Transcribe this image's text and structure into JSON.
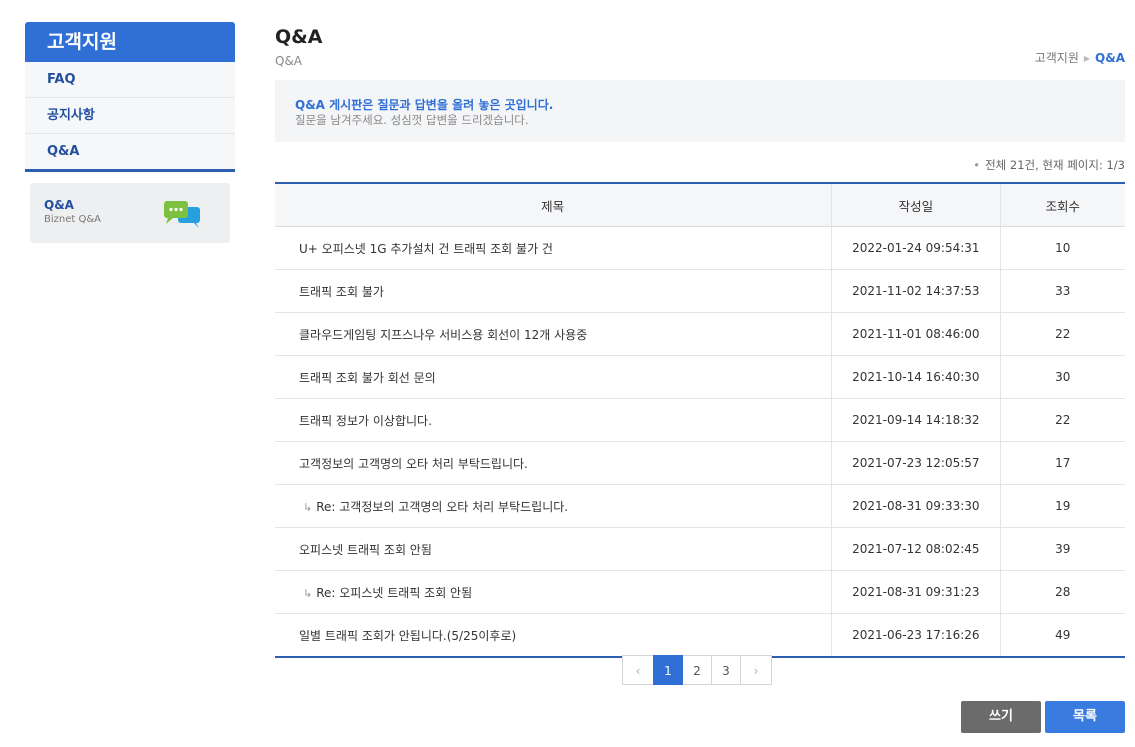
{
  "sidebar": {
    "title": "고객지원",
    "items": [
      {
        "label": "FAQ"
      },
      {
        "label": "공지사항"
      },
      {
        "label": "Q&A"
      }
    ],
    "card": {
      "title": "Q&A",
      "subtitle": "Biznet Q&A",
      "icon": "chat-bubbles-icon"
    }
  },
  "header": {
    "title": "Q&A",
    "subtitle": "Q&A",
    "breadcrumb": [
      "고객지원",
      "Q&A"
    ]
  },
  "notice": {
    "line1": "Q&A 게시판은 질문과 답변을 올려 놓은 곳입니다.",
    "line2": "질문을 남겨주세요. 성심껏 답변을 드리겠습니다."
  },
  "count": "전체 21건, 현재 페이지: 1/3",
  "table": {
    "columns": [
      "제목",
      "작성일",
      "조회수"
    ],
    "rows": [
      {
        "title": "U+ 오피스넷 1G 추가설치 건 트래픽 조회 불가 건",
        "date": "2022-01-24 09:54:31",
        "hits": "10",
        "reply": false
      },
      {
        "title": "트래픽 조회 불가",
        "date": "2021-11-02 14:37:53",
        "hits": "33",
        "reply": false
      },
      {
        "title": "클라우드게임팅 지프스나우 서비스용 회선이 12개 사용중",
        "date": "2021-11-01 08:46:00",
        "hits": "22",
        "reply": false
      },
      {
        "title": "트래픽 조회 불가 회선 문의",
        "date": "2021-10-14 16:40:30",
        "hits": "30",
        "reply": false
      },
      {
        "title": "트래픽 정보가 이상합니다.",
        "date": "2021-09-14 14:18:32",
        "hits": "22",
        "reply": false
      },
      {
        "title": "고객정보의 고객명의 오타 처리 부탁드립니다.",
        "date": "2021-07-23 12:05:57",
        "hits": "17",
        "reply": false
      },
      {
        "title": "Re: 고객정보의 고객명의 오타 처리 부탁드립니다.",
        "date": "2021-08-31 09:33:30",
        "hits": "19",
        "reply": true
      },
      {
        "title": "오피스넷 트래픽 조회 안됨",
        "date": "2021-07-12 08:02:45",
        "hits": "39",
        "reply": false
      },
      {
        "title": "Re: 오피스넷 트래픽 조회 안됨",
        "date": "2021-08-31 09:31:23",
        "hits": "28",
        "reply": true
      },
      {
        "title": "일별 트래픽 조회가 안됩니다.(5/25이후로)",
        "date": "2021-06-23 17:16:26",
        "hits": "49",
        "reply": false
      }
    ]
  },
  "pagination": {
    "prev": "‹",
    "pages": [
      "1",
      "2",
      "3"
    ],
    "current": "1",
    "next": "›"
  },
  "buttons": {
    "write": "쓰기",
    "list": "목록"
  },
  "colors": {
    "accent": "#2f6fd6",
    "table_border": "#2c5fb3",
    "write_button": "#6b6b6b",
    "list_button": "#3a7be0"
  }
}
